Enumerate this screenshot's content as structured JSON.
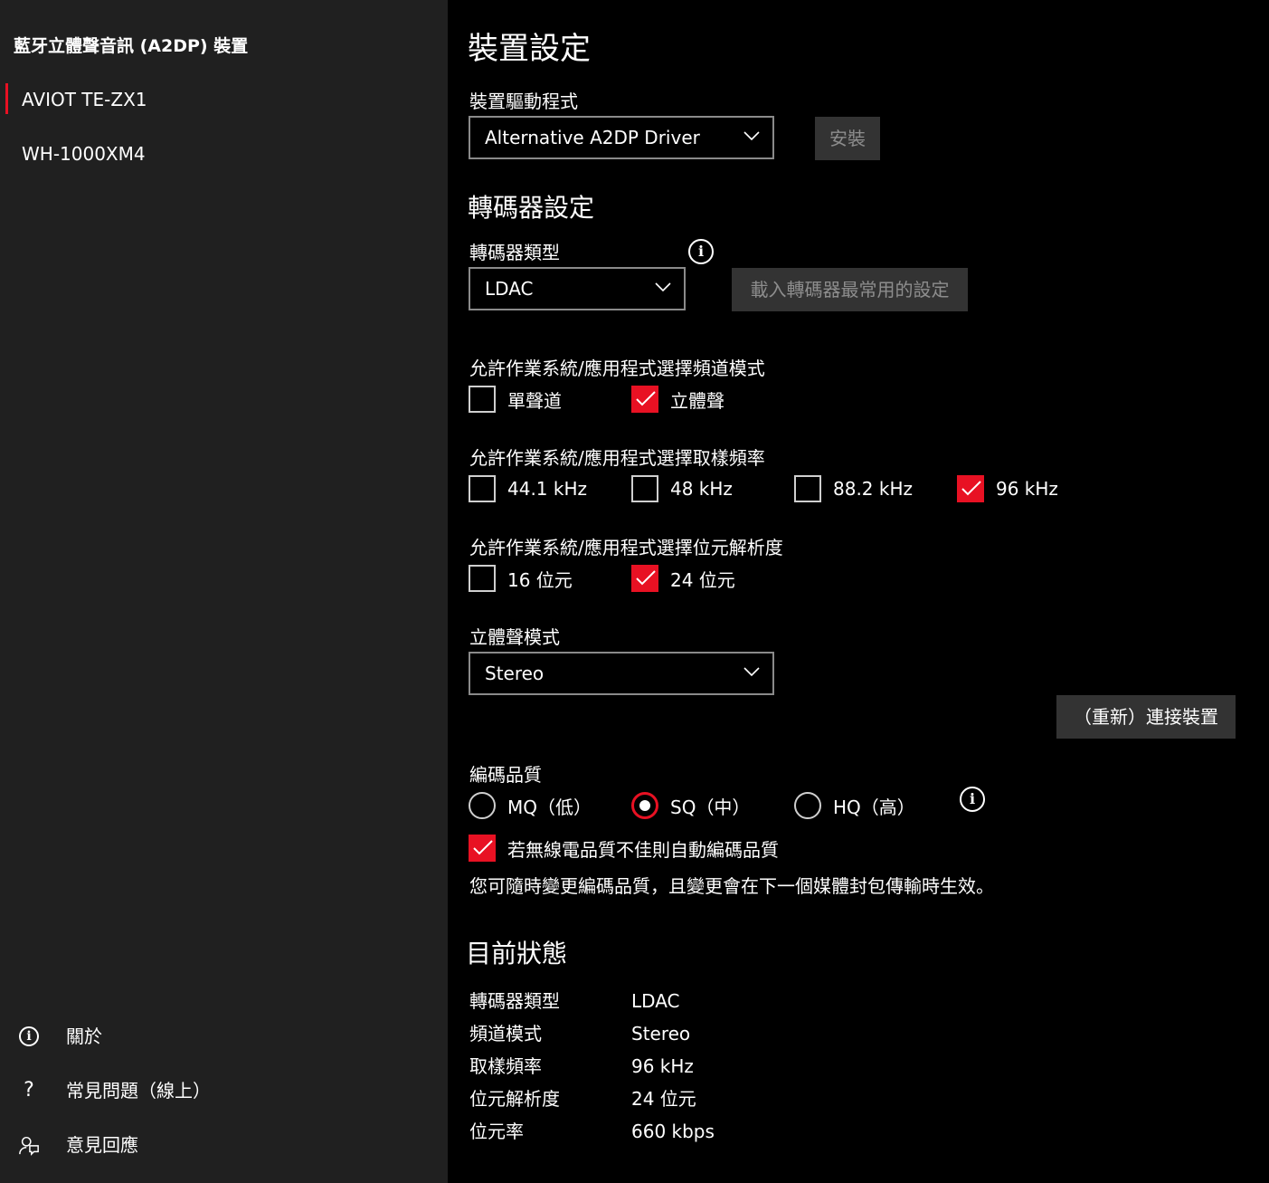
{
  "sidebar": {
    "title": "藍牙立體聲音訊 (A2DP) 裝置",
    "devices": [
      {
        "label": "AVIOT TE-ZX1",
        "selected": true
      },
      {
        "label": "WH-1000XM4",
        "selected": false
      }
    ],
    "footer": [
      {
        "icon": "info-icon",
        "label": "關於"
      },
      {
        "icon": "question-icon",
        "label": "常見問題（線上）"
      },
      {
        "icon": "feedback-icon",
        "label": "意見回應"
      }
    ]
  },
  "device_settings": {
    "title": "裝置設定",
    "driver_label": "裝置驅動程式",
    "driver_value": "Alternative A2DP Driver",
    "install_label": "安裝"
  },
  "codec_settings": {
    "title": "轉碼器設定",
    "codec_type_label": "轉碼器類型",
    "codec_type_value": "LDAC",
    "load_defaults_label": "載入轉碼器最常用的設定",
    "channel_mode": {
      "label": "允許作業系統/應用程式選擇頻道模式",
      "options": [
        {
          "label": "單聲道",
          "checked": false
        },
        {
          "label": "立體聲",
          "checked": true
        }
      ]
    },
    "sample_rate": {
      "label": "允許作業系統/應用程式選擇取樣頻率",
      "options": [
        {
          "label": "44.1 kHz",
          "checked": false
        },
        {
          "label": "48 kHz",
          "checked": false
        },
        {
          "label": "88.2 kHz",
          "checked": false
        },
        {
          "label": "96 kHz",
          "checked": true
        }
      ]
    },
    "bit_depth": {
      "label": "允許作業系統/應用程式選擇位元解析度",
      "options": [
        {
          "label": "16 位元",
          "checked": false
        },
        {
          "label": "24 位元",
          "checked": true
        }
      ]
    },
    "stereo_mode_label": "立體聲模式",
    "stereo_mode_value": "Stereo",
    "reconnect_label": "（重新）連接裝置",
    "quality": {
      "label": "編碼品質",
      "options": [
        {
          "label": "MQ（低）",
          "selected": false
        },
        {
          "label": "SQ（中）",
          "selected": true
        },
        {
          "label": "HQ（高）",
          "selected": false
        }
      ],
      "auto_label": "若無線電品質不佳則自動編碼品質",
      "auto_checked": true,
      "note": "您可隨時變更編碼品質，且變更會在下一個媒體封包傳輸時生效。"
    }
  },
  "status": {
    "title": "目前狀態",
    "rows": [
      {
        "key": "轉碼器類型",
        "value": "LDAC"
      },
      {
        "key": "頻道模式",
        "value": "Stereo"
      },
      {
        "key": "取樣頻率",
        "value": "96 kHz"
      },
      {
        "key": "位元解析度",
        "value": "24 位元"
      },
      {
        "key": "位元率",
        "value": "660 kbps"
      }
    ]
  },
  "colors": {
    "accent": "#e81123",
    "sidebar_bg": "#202020",
    "main_bg": "#000000",
    "button_bg": "#333333"
  }
}
